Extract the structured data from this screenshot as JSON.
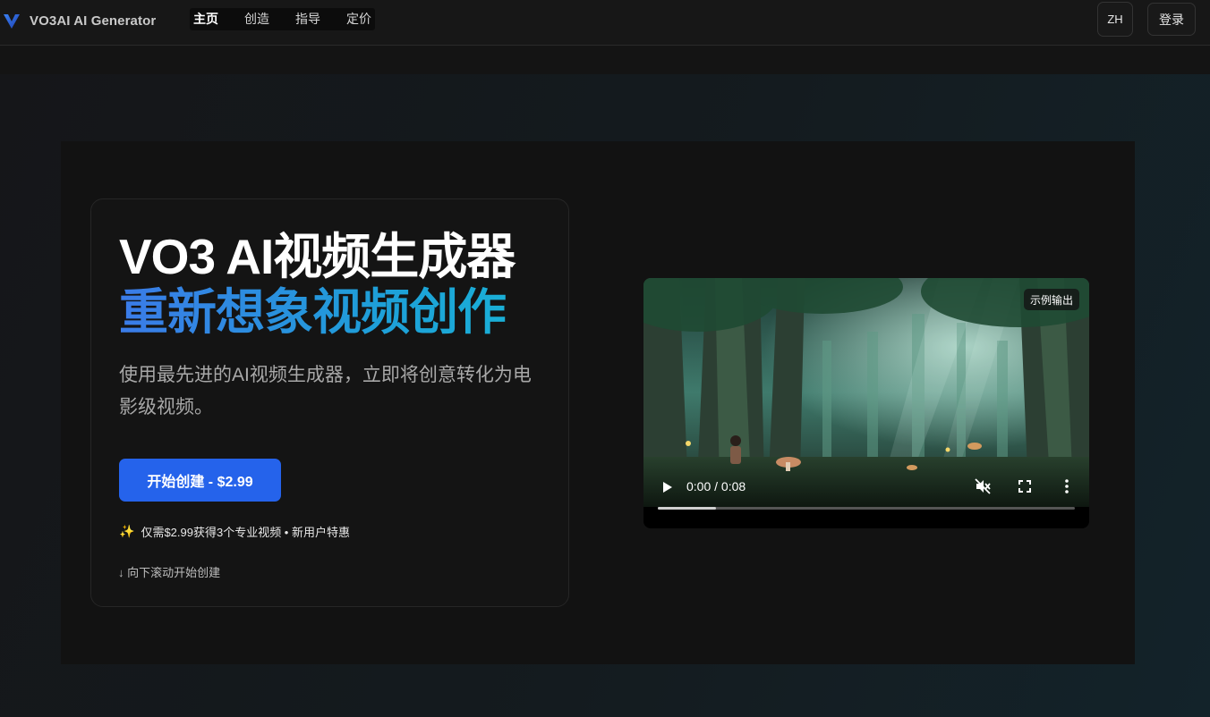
{
  "header": {
    "brand": "VO3AI AI Generator",
    "nav": [
      "主页",
      "创造",
      "指导",
      "定价"
    ],
    "active_nav": "主页",
    "lang_label": "ZH",
    "login_label": "登录"
  },
  "hero": {
    "title_line1": "VO3 AI视频生成器",
    "title_line2": "重新想象视频创作",
    "subtitle": "使用最先进的AI视频生成器，立即将创意转化为电影级视频。",
    "cta_label": "开始创建 - $2.99",
    "promo_text": "仅需$2.99获得3个专业视频 • 新用户特惠",
    "scroll_hint": "↓ 向下滚动开始创建"
  },
  "video": {
    "badge": "示例输出",
    "time": "0:00 / 0:08",
    "progress": 0.14
  },
  "icons": {
    "logo": "v-logo-icon",
    "play": "play-icon",
    "mute": "muted-icon",
    "fullscreen": "fullscreen-icon",
    "more": "more-vertical-icon",
    "sparkle": "sparkle-icon"
  },
  "colors": {
    "accent": "#2563eb",
    "gradient_start": "#3b7be8",
    "gradient_end": "#18b4d6"
  }
}
